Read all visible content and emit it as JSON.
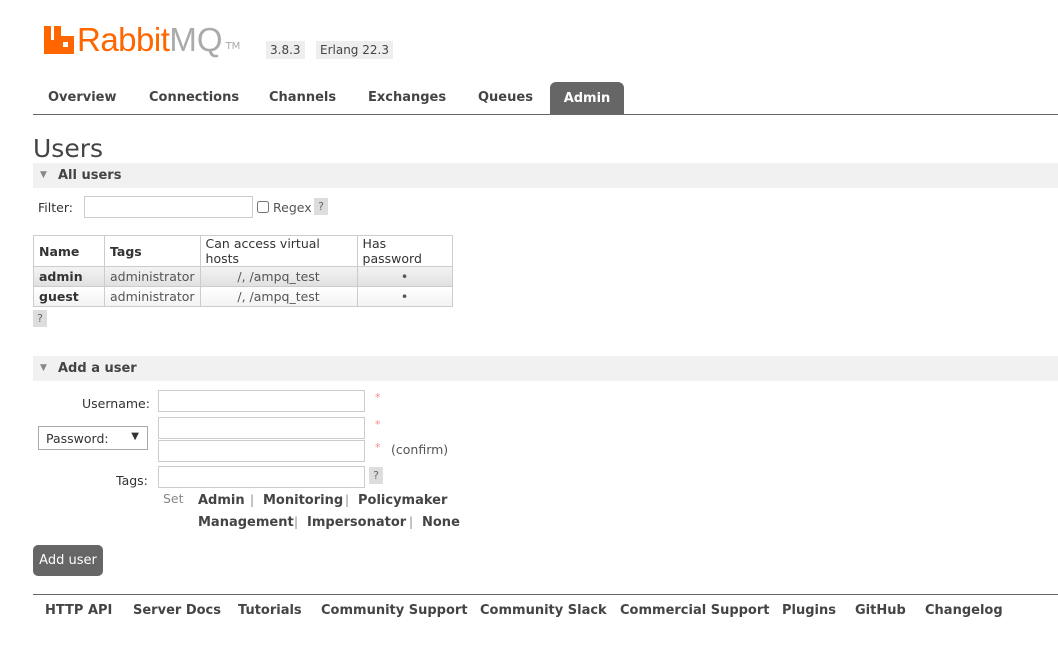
{
  "header": {
    "logo_text": "RabbitMQ",
    "version": "3.8.3",
    "erlang": "Erlang 22.3"
  },
  "nav": [
    "Overview",
    "Connections",
    "Channels",
    "Exchanges",
    "Queues",
    "Admin"
  ],
  "page_title": "Users",
  "all_users": {
    "title": "All users",
    "filter_label": "Filter:",
    "filter_value": "",
    "regex_label": "Regex",
    "help": "?",
    "columns": [
      "Name",
      "Tags",
      "Can access virtual hosts",
      "Has password"
    ],
    "rows": [
      [
        "admin",
        "administrator",
        "/, /ampq_test",
        "•"
      ],
      [
        "guest",
        "administrator",
        "/, /ampq_test",
        "•"
      ]
    ]
  },
  "add_user": {
    "title": "Add a user",
    "username_label": "Username:",
    "password_select": "Password:",
    "confirm": "(confirm)",
    "tags_label": "Tags:",
    "required": "*",
    "set_label": "Set",
    "tags": [
      "Admin",
      "Monitoring",
      "Policymaker",
      "Management",
      "Impersonator",
      "None"
    ],
    "sep": "|",
    "submit": "Add user"
  },
  "footer": [
    "HTTP API",
    "Server Docs",
    "Tutorials",
    "Community Support",
    "Community Slack",
    "Commercial Support",
    "Plugins",
    "GitHub",
    "Changelog"
  ]
}
